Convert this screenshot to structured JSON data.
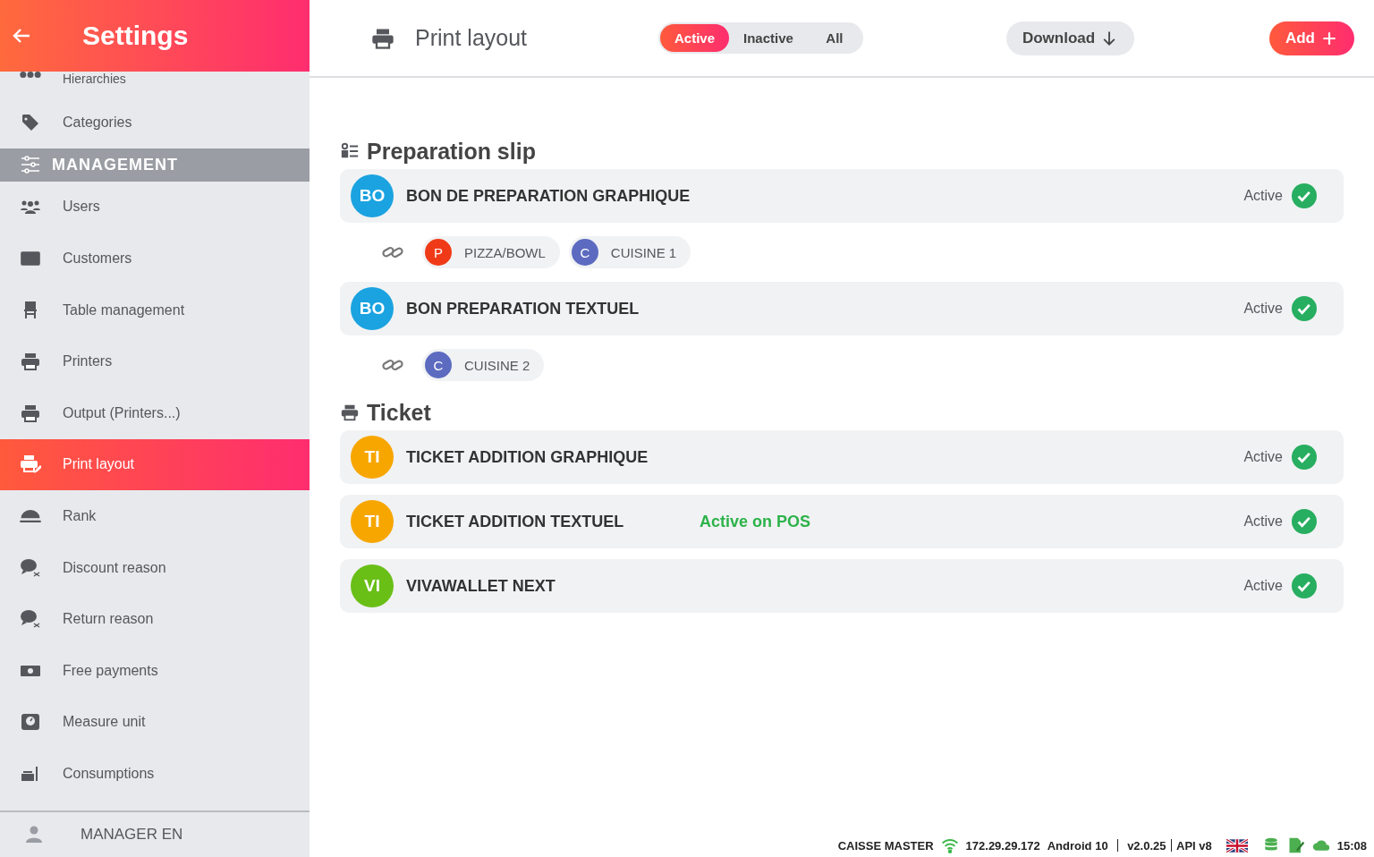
{
  "sidebar": {
    "title": "Settings",
    "items": [
      {
        "kind": "item",
        "label": "Hierarchies",
        "selected": false
      },
      {
        "kind": "item",
        "label": "Categories",
        "selected": false
      },
      {
        "kind": "section",
        "label": "MANAGEMENT"
      },
      {
        "kind": "item",
        "label": "Users",
        "selected": false
      },
      {
        "kind": "item",
        "label": "Customers",
        "selected": false
      },
      {
        "kind": "item",
        "label": "Table management",
        "selected": false
      },
      {
        "kind": "item",
        "label": "Printers",
        "selected": false
      },
      {
        "kind": "item",
        "label": "Output (Printers...)",
        "selected": false
      },
      {
        "kind": "item",
        "label": "Print layout",
        "selected": true
      },
      {
        "kind": "item",
        "label": "Rank",
        "selected": false
      },
      {
        "kind": "item",
        "label": "Discount reason",
        "selected": false
      },
      {
        "kind": "item",
        "label": "Return reason",
        "selected": false
      },
      {
        "kind": "item",
        "label": "Free payments",
        "selected": false
      },
      {
        "kind": "item",
        "label": "Measure unit",
        "selected": false
      },
      {
        "kind": "item",
        "label": "Consumptions",
        "selected": false
      }
    ],
    "user": "MANAGER EN"
  },
  "toolbar": {
    "title": "Print layout",
    "filters": [
      {
        "label": "Active",
        "selected": true
      },
      {
        "label": "Inactive",
        "selected": false
      },
      {
        "label": "All",
        "selected": false
      }
    ],
    "download": "Download",
    "add": "Add"
  },
  "groups": [
    {
      "title": "Preparation slip",
      "layouts": [
        {
          "initials": "BO",
          "color": "#1aa3e0",
          "name": "BON DE PREPARATION GRAPHIQUE",
          "status": "Active",
          "active": true,
          "links": [
            {
              "initial": "P",
              "color": "#f03a17",
              "label": "PIZZA/BOWL"
            },
            {
              "initial": "C",
              "color": "#5c6bc0",
              "label": "CUISINE 1"
            }
          ]
        },
        {
          "initials": "BO",
          "color": "#1aa3e0",
          "name": "BON PREPARATION TEXTUEL",
          "status": "Active",
          "active": true,
          "links": [
            {
              "initial": "C",
              "color": "#5c6bc0",
              "label": "CUISINE 2"
            }
          ]
        }
      ]
    },
    {
      "title": "Ticket",
      "layouts": [
        {
          "initials": "TI",
          "color": "#f7a600",
          "name": "TICKET ADDITION GRAPHIQUE",
          "status": "Active",
          "active": true
        },
        {
          "initials": "TI",
          "color": "#f7a600",
          "name": "TICKET ADDITION TEXTUEL",
          "note": "Active on POS",
          "status": "Active",
          "active": true
        },
        {
          "initials": "VI",
          "color": "#6abf17",
          "name": "VIVAWALLET NEXT",
          "status": "Active",
          "active": true
        }
      ]
    }
  ],
  "status_bar": {
    "device": "CAISSE MASTER",
    "ip": "172.29.29.172",
    "os": "Android 10",
    "version": "v2.0.25",
    "api": "API v8",
    "time": "15:08"
  }
}
